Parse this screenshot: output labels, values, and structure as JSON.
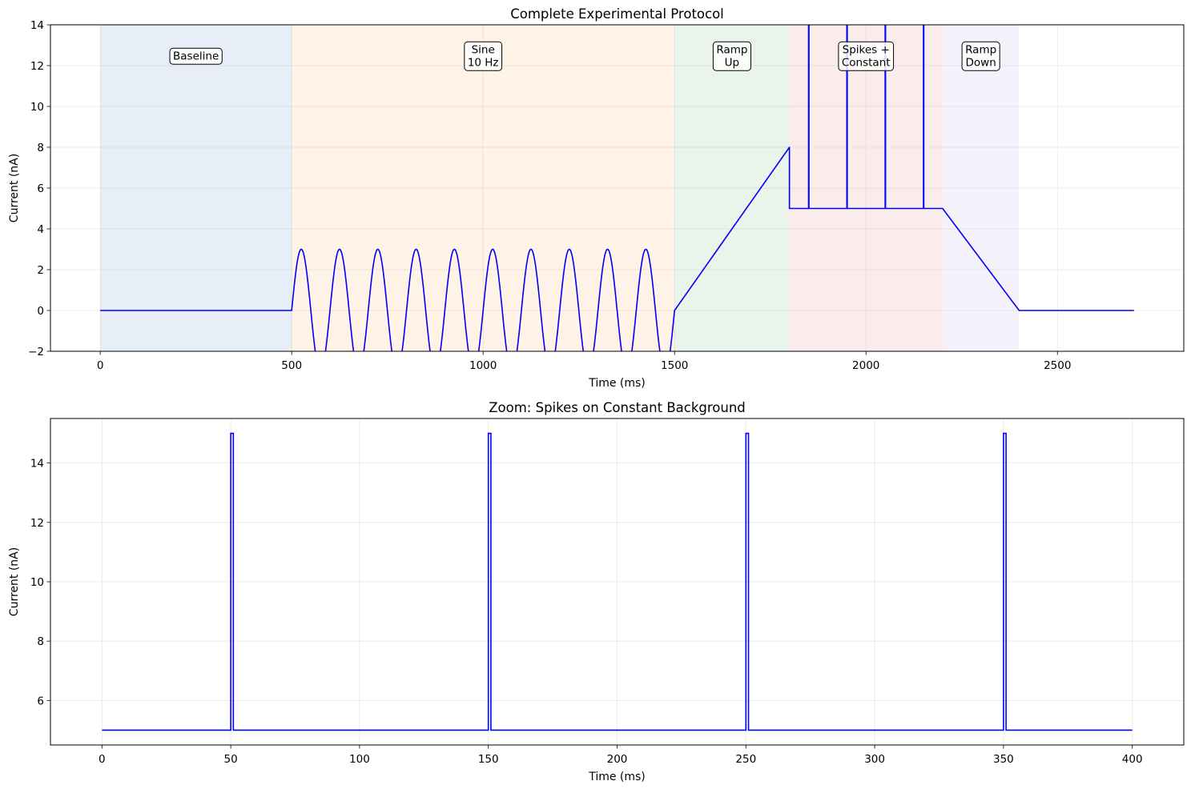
{
  "chart_data": [
    {
      "type": "line",
      "title": "Complete Experimental Protocol",
      "xlabel": "Time (ms)",
      "ylabel": "Current (nA)",
      "xlim": [
        -130,
        2830
      ],
      "ylim": [
        -2,
        14
      ],
      "xticks": [
        0,
        500,
        1000,
        1500,
        2000,
        2500
      ],
      "yticks": [
        -2,
        0,
        2,
        4,
        6,
        8,
        10,
        12,
        14
      ],
      "grid": true,
      "line_color": "#0000ff",
      "phases": [
        {
          "label": "Baseline",
          "start": 0,
          "end": 500,
          "color": "#aec7e8",
          "label_x": 250
        },
        {
          "label": "Sine\n10 Hz",
          "start": 500,
          "end": 1500,
          "color": "#ffd8b0",
          "label_x": 1000
        },
        {
          "label": "Ramp\nUp",
          "start": 1500,
          "end": 1800,
          "color": "#b8dcb8",
          "label_x": 1650
        },
        {
          "label": "Spikes +\nConstant",
          "start": 1800,
          "end": 2200,
          "color": "#f2c0c0",
          "label_x": 2000
        },
        {
          "label": "Ramp\nDown",
          "start": 2200,
          "end": 2400,
          "color": "#e2d4f4",
          "label_x": 2300
        }
      ],
      "annotation_y": 12.5,
      "signal": {
        "baseline": {
          "start": 0,
          "end": 500,
          "value": 0
        },
        "sine": {
          "start": 500,
          "end": 1500,
          "frequency_hz": 10,
          "amplitude": 3,
          "offset": 0
        },
        "ramp_up": {
          "start": 1500,
          "end": 1800,
          "from": 0,
          "to": 8
        },
        "constant": {
          "start": 1800,
          "end": 2200,
          "value": 5
        },
        "spikes": {
          "times": [
            1850,
            1950,
            2050,
            2150
          ],
          "value": 15,
          "width": 1
        },
        "ramp_down": {
          "start": 2200,
          "end": 2400,
          "from": 5,
          "to": 0
        },
        "tail": {
          "start": 2400,
          "end": 2700,
          "value": 0
        }
      }
    },
    {
      "type": "line",
      "title": "Zoom: Spikes on Constant Background",
      "xlabel": "Time (ms)",
      "ylabel": "Current (nA)",
      "xlim": [
        -20,
        420
      ],
      "ylim": [
        4.5,
        15.5
      ],
      "xticks": [
        0,
        50,
        100,
        150,
        200,
        250,
        300,
        350,
        400
      ],
      "yticks": [
        6,
        8,
        10,
        12,
        14
      ],
      "grid": true,
      "line_color": "#0000ff",
      "signal": {
        "start": 0,
        "end": 400,
        "baseline": 5,
        "spikes": {
          "times": [
            50,
            150,
            250,
            350
          ],
          "value": 15,
          "width": 1
        }
      }
    }
  ]
}
